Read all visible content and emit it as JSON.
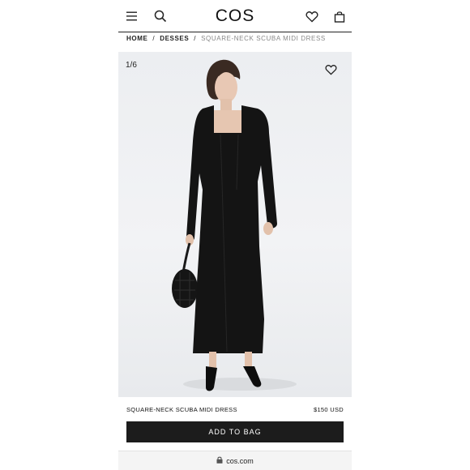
{
  "header": {
    "logo": "COS",
    "icons": [
      "menu-icon",
      "search-icon",
      "heart-icon",
      "bag-icon"
    ]
  },
  "breadcrumb": {
    "items": [
      "HOME",
      "DESSES",
      "SQUARE-NECK SCUBA MIDI DRESS"
    ],
    "separator": "/"
  },
  "gallery": {
    "counter": "1/6"
  },
  "product": {
    "name": "SQUARE-NECK SCUBA MIDI DRESS",
    "price": "$150 USD",
    "add_to_bag_label": "ADD TO BAG"
  },
  "browser": {
    "url": "cos.com"
  },
  "colors": {
    "button_bg": "#1c1c1c",
    "dress": "#141414",
    "background": "#eceef1"
  }
}
